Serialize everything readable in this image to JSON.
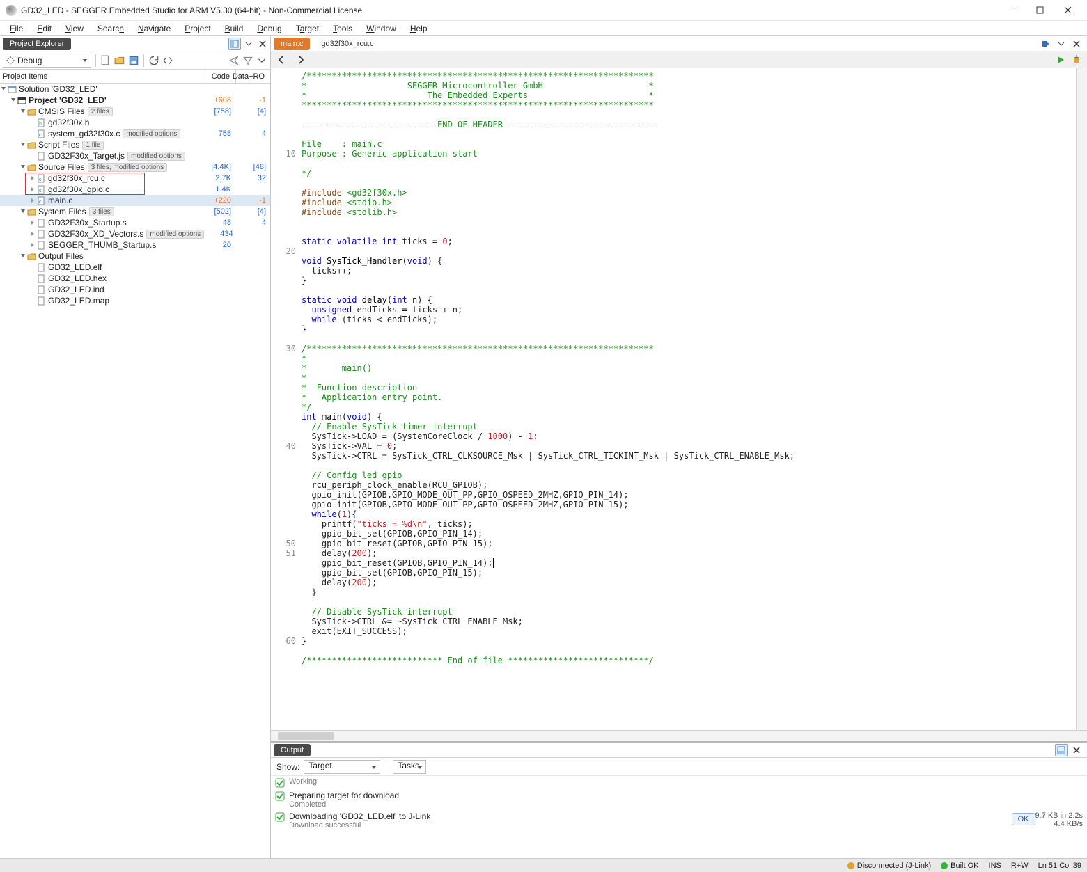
{
  "window": {
    "title": "GD32_LED - SEGGER Embedded Studio for ARM V5.30 (64-bit) - Non-Commercial License"
  },
  "menu": {
    "file": "File",
    "edit": "Edit",
    "view": "View",
    "search": "Search",
    "navigate": "Navigate",
    "project": "Project",
    "build": "Build",
    "debug": "Debug",
    "target": "Target",
    "tools": "Tools",
    "window": "Window",
    "help": "Help"
  },
  "explorer": {
    "title": "Project Explorer",
    "config": "Debug",
    "cols": {
      "items": "Project Items",
      "code": "Code",
      "dataro": "Data+RO"
    },
    "solution": "Solution 'GD32_LED'",
    "project": "Project 'GD32_LED'",
    "project_code": "+608",
    "project_dataro": "-1",
    "cmsis": "CMSIS Files",
    "cmsis_badge": "2 files",
    "cmsis_code": "[758]",
    "cmsis_dataro": "[4]",
    "f1": "gd32f30x.h",
    "f2": "system_gd32f30x.c",
    "f2_badge": "modified options",
    "f2_code": "758",
    "f2_dataro": "4",
    "script": "Script Files",
    "script_badge": "1 file",
    "f3": "GD32F30x_Target.js",
    "f3_badge": "modified options",
    "source": "Source Files",
    "source_badge": "3 files, modified options",
    "source_code": "[4.4K]",
    "source_dataro": "[48]",
    "f4": "gd32f30x_rcu.c",
    "f4_code": "2.7K",
    "f4_dataro": "32",
    "f5": "gd32f30x_gpio.c",
    "f5_code": "1.4K",
    "f6": "main.c",
    "f6_code": "+220",
    "f6_dataro": "-1",
    "system": "System Files",
    "system_badge": "3 files",
    "system_code": "[502]",
    "system_dataro": "[4]",
    "f7": "GD32F30x_Startup.s",
    "f7_code": "48",
    "f7_dataro": "4",
    "f8": "GD32F30x_XD_Vectors.s",
    "f8_badge": "modified options",
    "f8_code": "434",
    "f9": "SEGGER_THUMB_Startup.s",
    "f9_code": "20",
    "output_folder": "Output Files",
    "o1": "GD32_LED.elf",
    "o2": "GD32_LED.hex",
    "o3": "GD32_LED.ind",
    "o4": "GD32_LED.map"
  },
  "tabs": {
    "active": "main.c",
    "inactive": "gd32f30x_rcu.c"
  },
  "gutter": {
    "l10": "10",
    "l20": "20",
    "l30": "30",
    "l40": "40",
    "l50": "50",
    "l51": "51",
    "l60": "60"
  },
  "output": {
    "title": "Output",
    "show": "Show:",
    "target": "Target",
    "tasks": "Tasks",
    "working": "Working",
    "i1": "Preparing target for download",
    "i1s": "Completed",
    "i2": "Downloading 'GD32_LED.elf' to J-Link",
    "i2s": "Download successful",
    "rate1": "9.7 KB in 2.2s",
    "rate2": "4.4 KB/s",
    "ok": "OK"
  },
  "status": {
    "disconnected": "Disconnected (J-Link)",
    "built": "Built OK",
    "ins": "INS",
    "rw": "R+W",
    "pos": "Ln 51 Col 39"
  }
}
